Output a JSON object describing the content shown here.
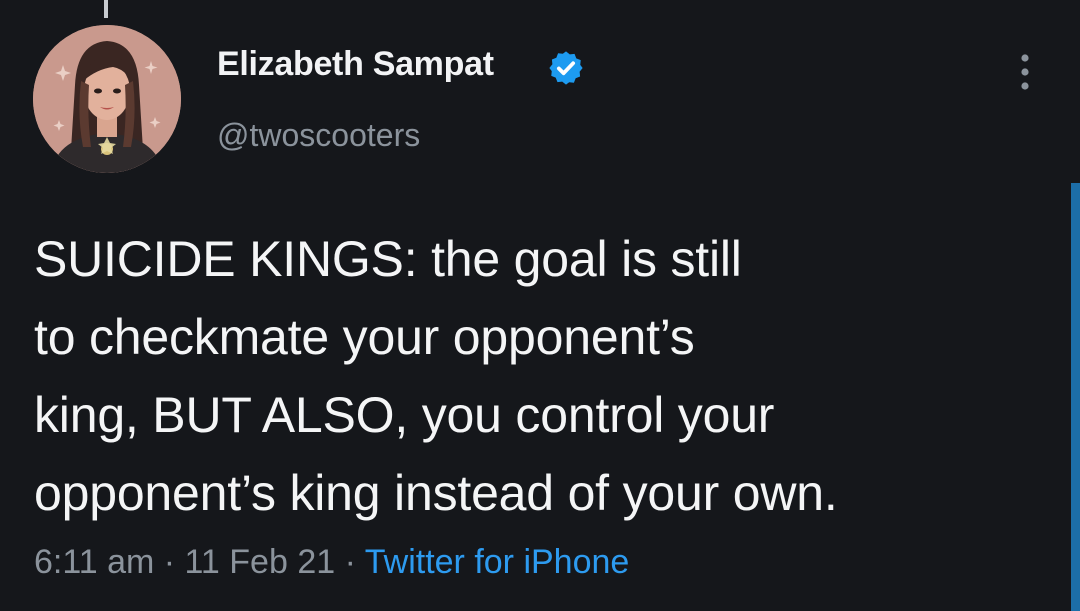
{
  "tweet": {
    "display_name": "Elizabeth Sampat",
    "handle": "@twoscooters",
    "text": "SUICIDE KINGS: the goal is still\nto checkmate your opponent’s\nking, BUT ALSO, you control your\nopponent’s king instead of your own.",
    "time": "6:11 am",
    "separator": " · ",
    "date": "11 Feb 21",
    "source": "Twitter for iPhone"
  },
  "icons": {
    "verified": "verified-badge-icon",
    "more": "more-vertical-icon",
    "avatar": "avatar-illustration"
  },
  "colors": {
    "background": "#15171b",
    "text": "#f4f5f6",
    "muted": "#8b939c",
    "link": "#2d9bf0",
    "verified": "#1d9bf0"
  }
}
